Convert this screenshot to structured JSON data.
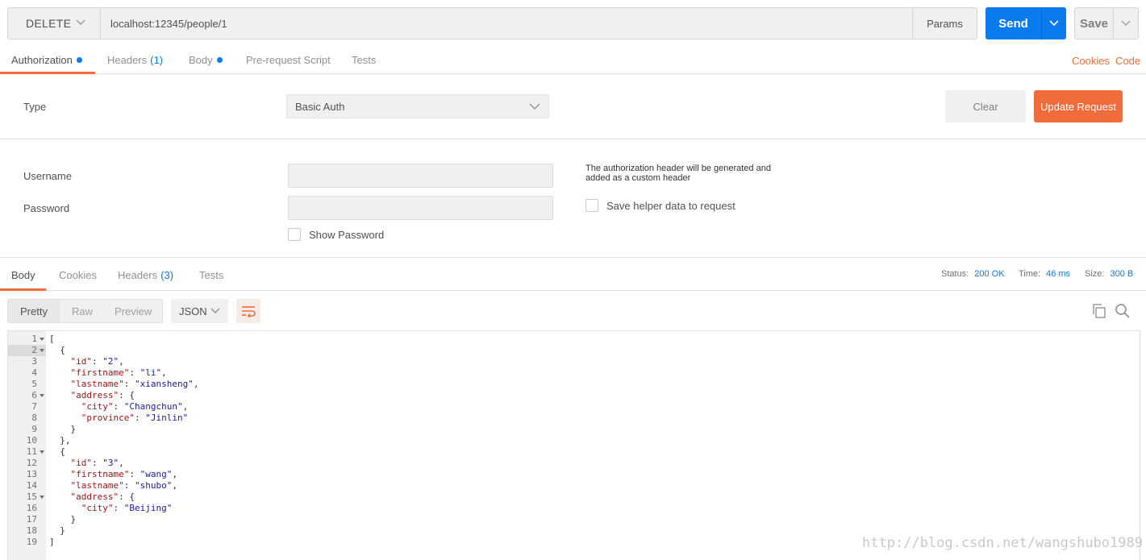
{
  "urlbar": {
    "method": "DELETE",
    "url": "localhost:12345/people/1",
    "params_label": "Params",
    "send_label": "Send",
    "save_label": "Save"
  },
  "request_tabs": {
    "authorization": "Authorization",
    "headers": "Headers",
    "headers_count": "(1)",
    "body": "Body",
    "pre_request": "Pre-request Script",
    "tests": "Tests",
    "cookies_link": "Cookies",
    "code_link": "Code"
  },
  "auth": {
    "type_label": "Type",
    "type_value": "Basic Auth",
    "clear_label": "Clear",
    "update_label": "Update Request",
    "username_label": "Username",
    "password_label": "Password",
    "show_password_label": "Show Password",
    "note_line1": "The authorization header will be generated and",
    "note_line2": "added as a custom header",
    "save_helper_label": "Save helper data to request"
  },
  "response_tabs": {
    "body": "Body",
    "cookies": "Cookies",
    "headers": "Headers",
    "headers_count": "(3)",
    "tests": "Tests"
  },
  "status": {
    "status_label": "Status:",
    "status_value": "200 OK",
    "time_label": "Time:",
    "time_value": "46 ms",
    "size_label": "Size:",
    "size_value": "300 B"
  },
  "viewer": {
    "pretty": "Pretty",
    "raw": "Raw",
    "preview": "Preview",
    "format": "JSON"
  },
  "code_lines": [
    "[",
    "  {",
    "    \"id\": \"2\",",
    "    \"firstname\": \"li\",",
    "    \"lastname\": \"xiansheng\",",
    "    \"address\": {",
    "      \"city\": \"Changchun\",",
    "      \"province\": \"Jinlin\"",
    "    }",
    "  },",
    "  {",
    "    \"id\": \"3\",",
    "    \"firstname\": \"wang\",",
    "    \"lastname\": \"shubo\",",
    "    \"address\": {",
    "      \"city\": \"Beijing\"",
    "    }",
    "  }",
    "]"
  ],
  "fold_lines": [
    1,
    2,
    6,
    11,
    15
  ],
  "highlight_line": 2,
  "watermark": "http://blog.csdn.net/wangshubo1989",
  "colors": {
    "accent_orange": "#f26b3a",
    "accent_blue": "#097bed",
    "json_key": "#a31515",
    "json_string": "#1a1aa6"
  }
}
